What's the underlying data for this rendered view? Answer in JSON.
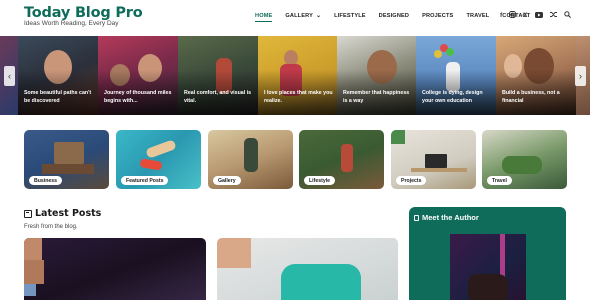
{
  "site": {
    "title": "Today Blog Pro",
    "tagline": "Ideas Worth Reading, Every Day"
  },
  "nav": {
    "items": [
      {
        "label": "HOME",
        "active": true
      },
      {
        "label": "GALLERY",
        "dropdown": true
      },
      {
        "label": "LIFESTYLE"
      },
      {
        "label": "DESIGNED"
      },
      {
        "label": "PROJECTS"
      },
      {
        "label": "TRAVEL"
      },
      {
        "label": "CONTACT"
      }
    ],
    "social_icons": [
      "facebook-icon",
      "instagram-icon",
      "x-twitter-icon",
      "youtube-icon",
      "shuffle-icon",
      "search-icon"
    ]
  },
  "slider": {
    "slides": [
      {
        "caption": ""
      },
      {
        "caption": "Some beautiful paths can't be discovered"
      },
      {
        "caption": "Journey of thousand miles begins with..."
      },
      {
        "caption": "Real comfort, and visual is vital."
      },
      {
        "caption": "I love places that make you realize."
      },
      {
        "caption": "Remember that happiness is a way"
      },
      {
        "caption": "College is dying, design your own education"
      },
      {
        "caption": "Build a business, not a financial"
      },
      {
        "caption": ""
      }
    ],
    "prev_icon": "chevron-left-icon",
    "next_icon": "chevron-right-icon"
  },
  "categories": [
    {
      "label": "Business"
    },
    {
      "label": "Featured Posts"
    },
    {
      "label": "Gallery"
    },
    {
      "label": "Lifestyle"
    },
    {
      "label": "Projects"
    },
    {
      "label": "Travel"
    }
  ],
  "latest": {
    "title": "Latest Posts",
    "subtitle": "Fresh from the blog."
  },
  "author": {
    "title": "Meet the Author"
  },
  "colors": {
    "brand": "#0f6b5a"
  }
}
